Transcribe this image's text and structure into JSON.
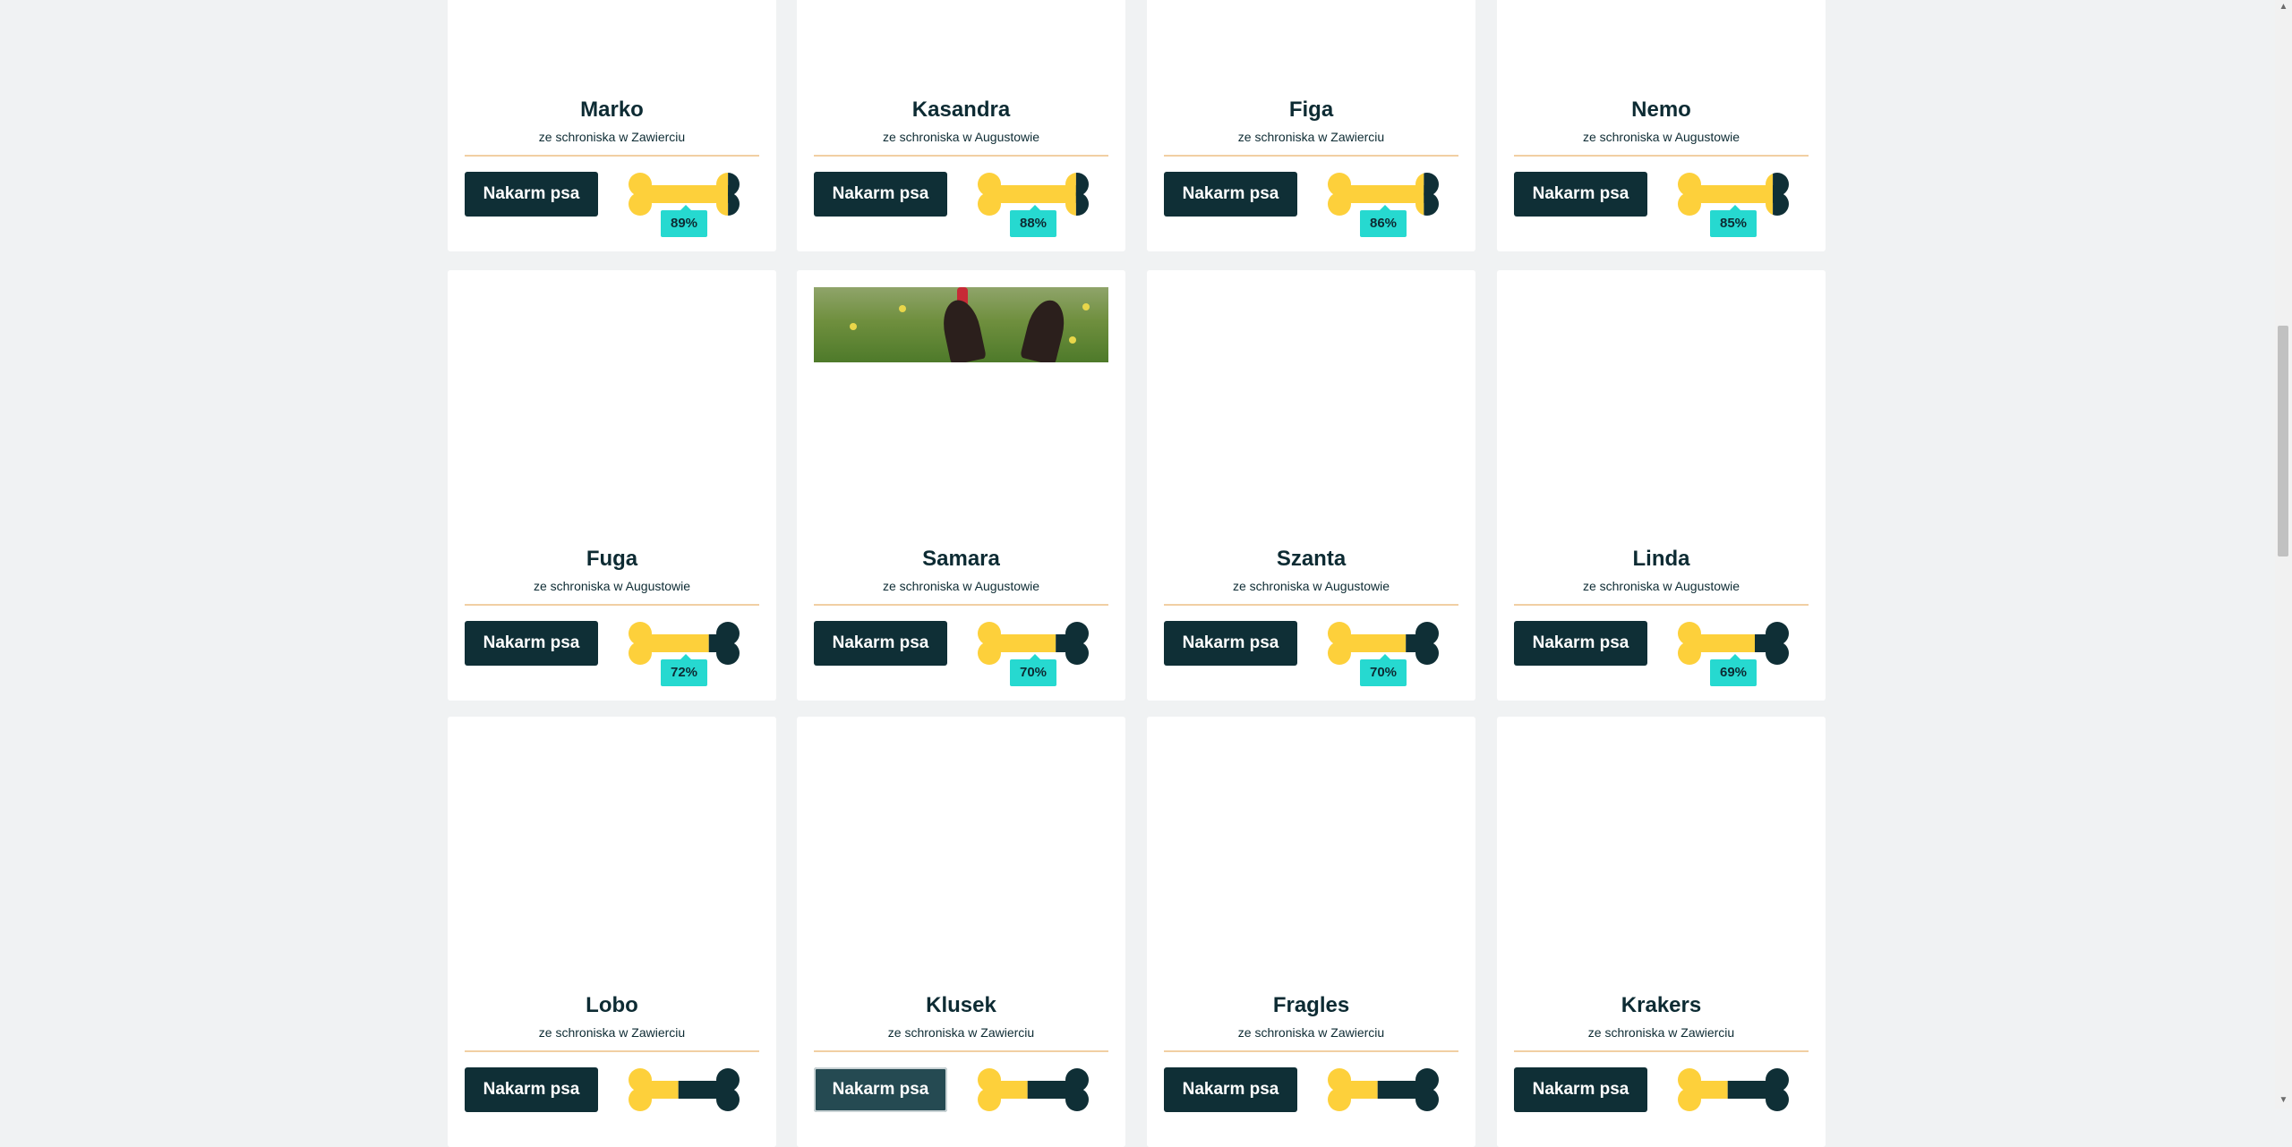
{
  "feed_button_label": "Nakarm psa",
  "colors": {
    "background": "#f0f2f3",
    "card": "#ffffff",
    "dark": "#0f2f36",
    "bone_fill": "#fdd03b",
    "percent_badge": "#26d9d0",
    "divider": "#f1cfa3"
  },
  "dogs": [
    {
      "name": "Marko",
      "shelter": "ze schroniska w Zawierciu",
      "fed_percent": "89%",
      "fed_fraction": 0.89
    },
    {
      "name": "Kasandra",
      "shelter": "ze schroniska w Augustowie",
      "fed_percent": "88%",
      "fed_fraction": 0.88
    },
    {
      "name": "Figa",
      "shelter": "ze schroniska w Zawierciu",
      "fed_percent": "86%",
      "fed_fraction": 0.86
    },
    {
      "name": "Nemo",
      "shelter": "ze schroniska w Augustowie",
      "fed_percent": "85%",
      "fed_fraction": 0.85
    },
    {
      "name": "Fuga",
      "shelter": "ze schroniska w Augustowie",
      "fed_percent": "72%",
      "fed_fraction": 0.72
    },
    {
      "name": "Samara",
      "shelter": "ze schroniska w Augustowie",
      "fed_percent": "70%",
      "fed_fraction": 0.7,
      "has_photo": true
    },
    {
      "name": "Szanta",
      "shelter": "ze schroniska w Augustowie",
      "fed_percent": "70%",
      "fed_fraction": 0.7
    },
    {
      "name": "Linda",
      "shelter": "ze schroniska w Augustowie",
      "fed_percent": "69%",
      "fed_fraction": 0.69
    },
    {
      "name": "Lobo",
      "shelter": "ze schroniska w Zawierciu",
      "fed_fraction": 0.45
    },
    {
      "name": "Klusek",
      "shelter": "ze schroniska w Zawierciu",
      "fed_fraction": 0.45,
      "hovered": true
    },
    {
      "name": "Fragles",
      "shelter": "ze schroniska w Zawierciu",
      "fed_fraction": 0.45
    },
    {
      "name": "Krakers",
      "shelter": "ze schroniska w Zawierciu",
      "fed_fraction": 0.45
    }
  ],
  "scrollbar": {
    "up_icon": "▲",
    "down_icon": "▼"
  }
}
